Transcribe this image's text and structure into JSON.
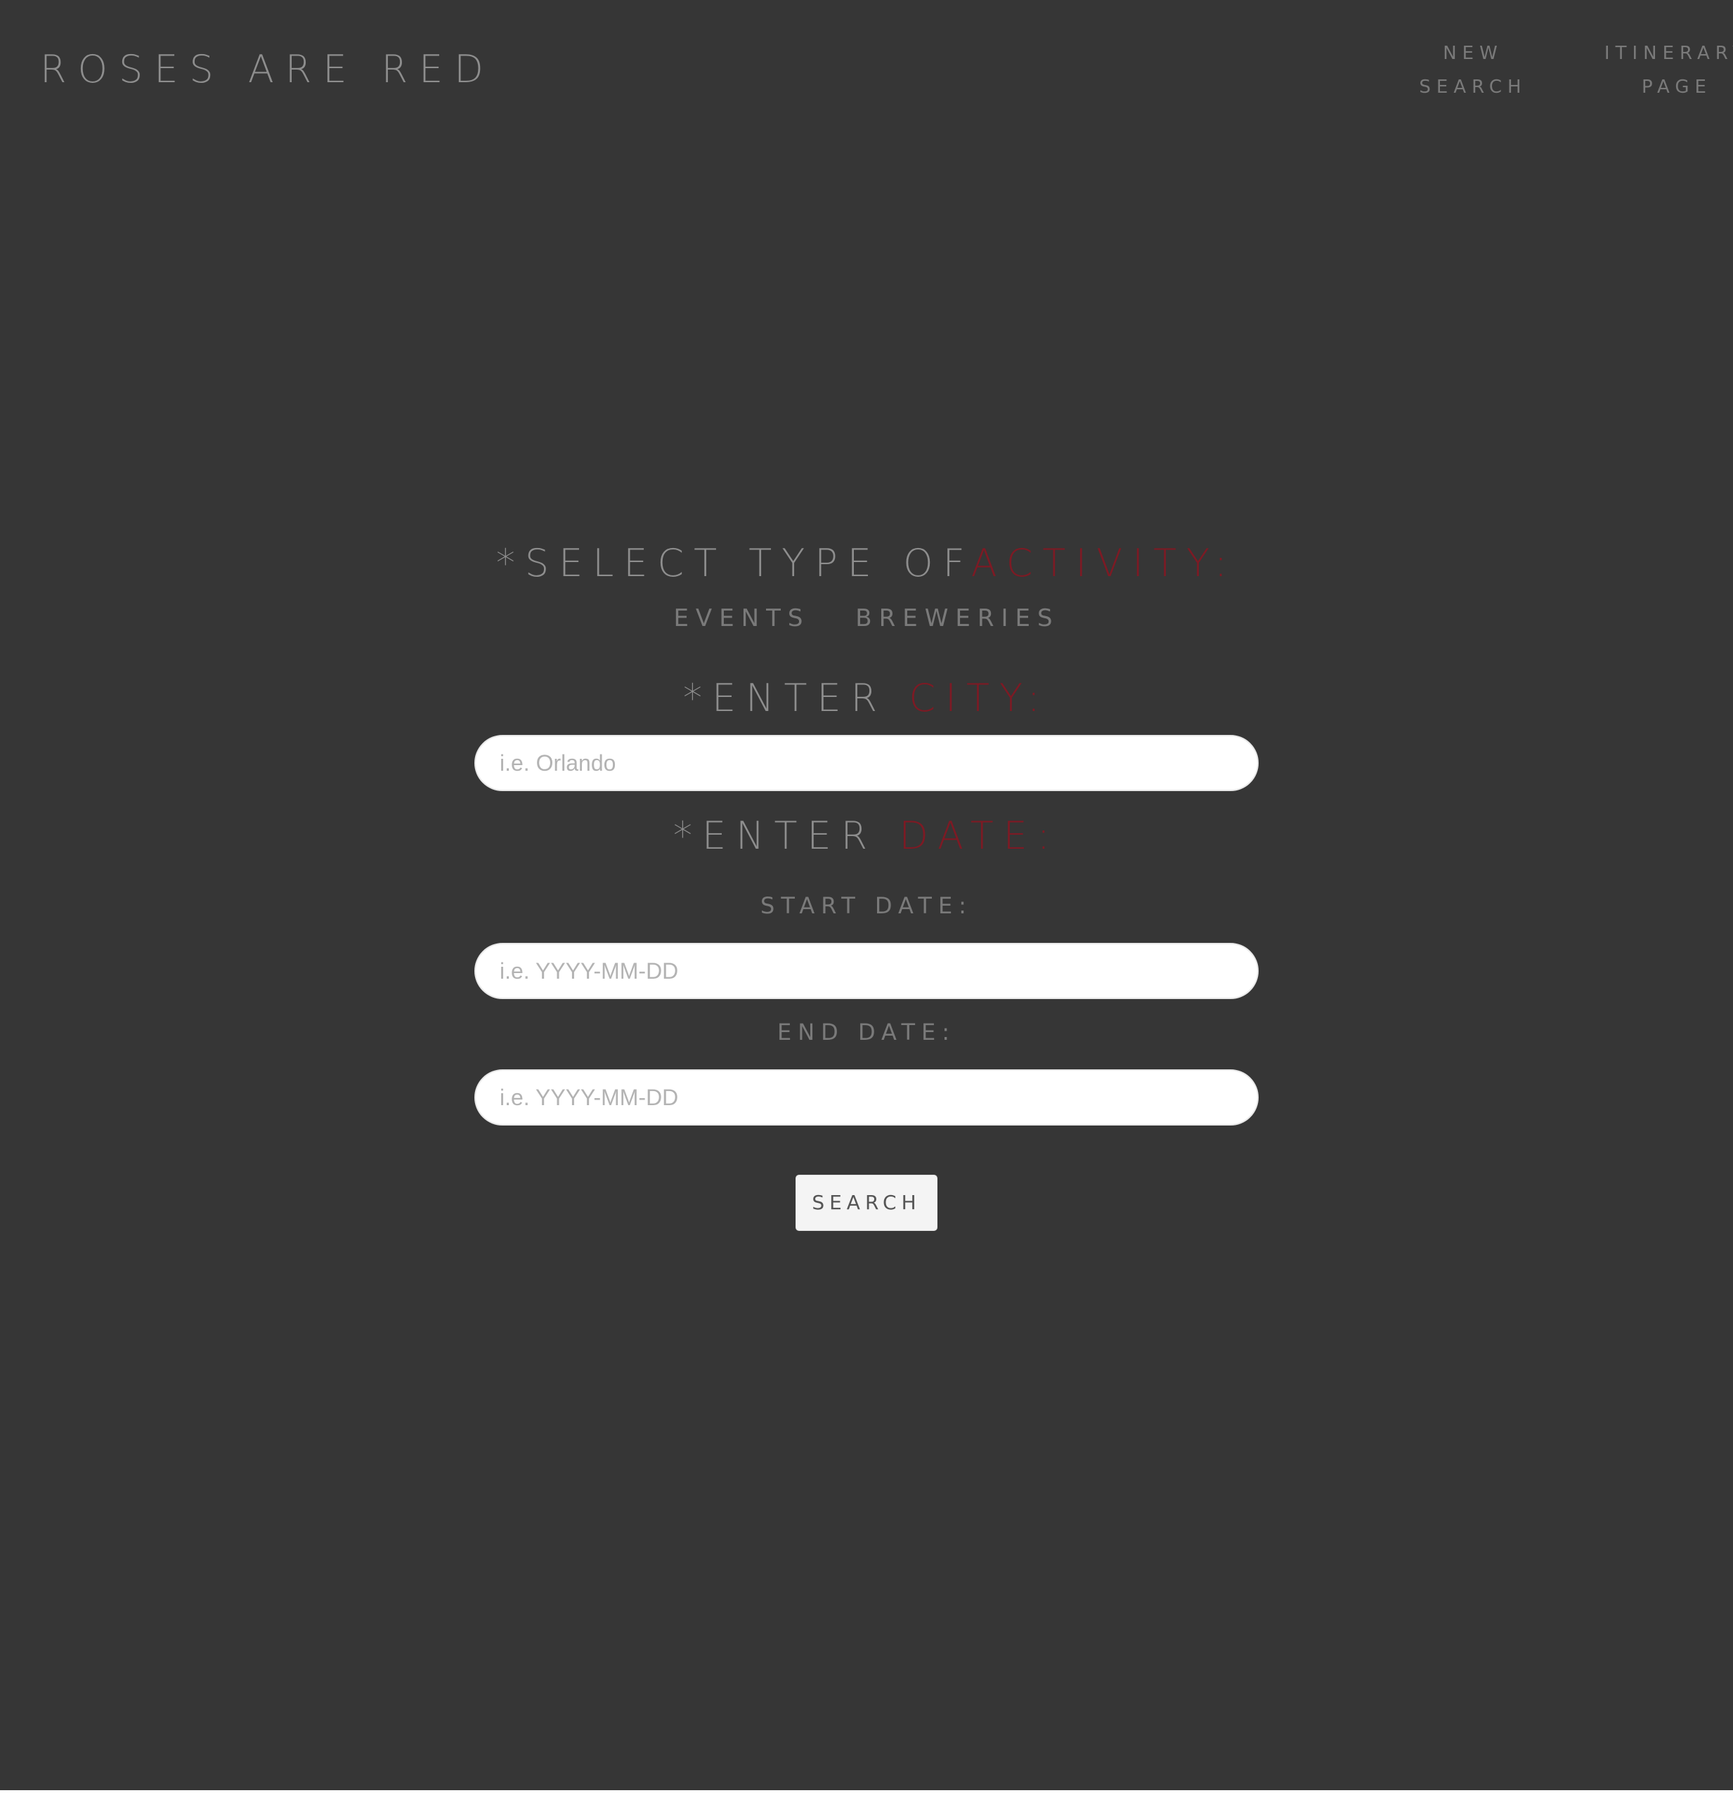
{
  "header": {
    "logo": "ROSES ARE RED",
    "nav": [
      {
        "line1": "NEW",
        "line2": "SEARCH"
      },
      {
        "line1": "ITINERARY",
        "line2": "PAGE"
      }
    ]
  },
  "form": {
    "activity_heading": {
      "prefix": "*SELECT TYPE OF",
      "accent": "ACTIVITY:"
    },
    "activity_options": [
      "EVENTS",
      "BREWERIES"
    ],
    "city_heading": {
      "prefix": "*ENTER ",
      "accent": "CITY:"
    },
    "city_placeholder": "i.e. Orlando",
    "date_heading": {
      "prefix": "*ENTER ",
      "accent": "DATE:"
    },
    "start_label": "START DATE:",
    "start_placeholder": "i.e. YYYY-MM-DD",
    "end_label": "END DATE:",
    "end_placeholder": "i.e. YYYY-MM-DD",
    "search_label": "SEARCH"
  },
  "colors": {
    "background": "#363636",
    "text": "#8e8e8e",
    "accent": "#7d1a24",
    "input_bg": "#ffffff",
    "button_bg": "#f4f4f4"
  }
}
